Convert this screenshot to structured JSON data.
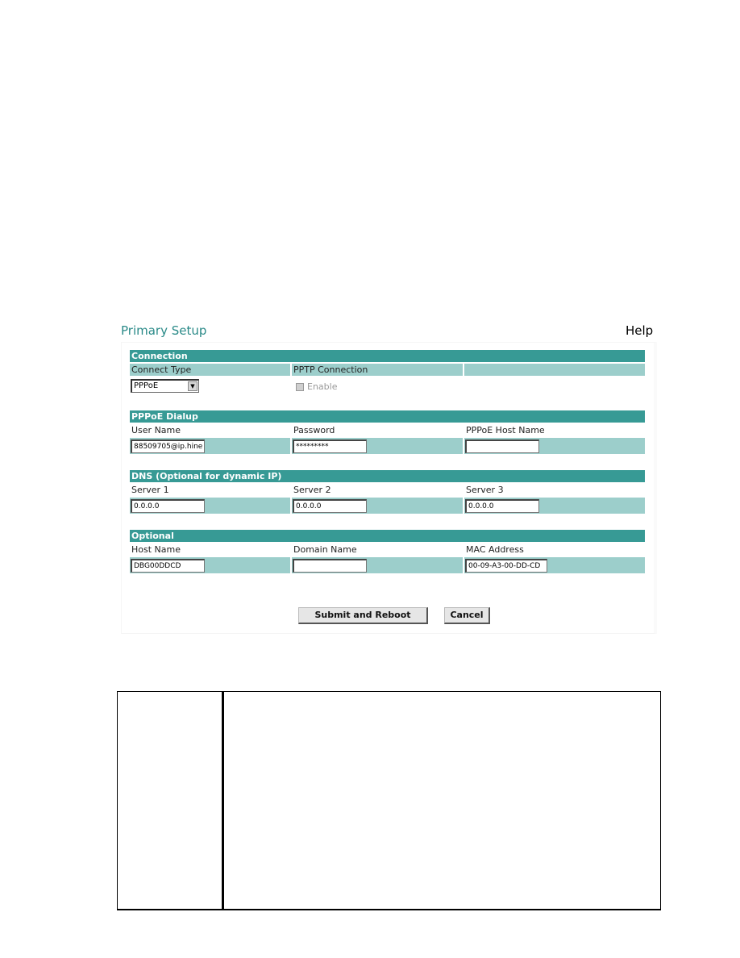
{
  "page": {
    "title": "Primary Setup",
    "help_label": "Help"
  },
  "colors": {
    "section_header": "#379a95",
    "field_row": "#9ccecb",
    "title_text": "#2a8a88"
  },
  "connection": {
    "header": "Connection",
    "connect_type_label": "Connect Type",
    "connect_type_value": "PPPoE",
    "pptp_label": "PPTP Connection",
    "enable_label": "Enable",
    "enable_checked": false,
    "enable_disabled": true
  },
  "pppoe": {
    "header": "PPPoE Dialup",
    "user_name_label": "User Name",
    "user_name_value": "88509705@ip.hine",
    "password_label": "Password",
    "password_value": "*********",
    "host_name_label": "PPPoE Host Name",
    "host_name_value": ""
  },
  "dns": {
    "header": "DNS (Optional for dynamic IP)",
    "servers": [
      {
        "label": "Server 1",
        "value": "0.0.0.0"
      },
      {
        "label": "Server 2",
        "value": "0.0.0.0"
      },
      {
        "label": "Server 3",
        "value": "0.0.0.0"
      }
    ]
  },
  "optional": {
    "header": "Optional",
    "host_name_label": "Host Name",
    "host_name_value": "DBG00DDCD",
    "domain_name_label": "Domain Name",
    "domain_name_value": "",
    "mac_label": "MAC Address",
    "mac_value": "00-09-A3-00-DD-CD"
  },
  "actions": {
    "submit_label": "Submit and Reboot",
    "cancel_label": "Cancel"
  }
}
